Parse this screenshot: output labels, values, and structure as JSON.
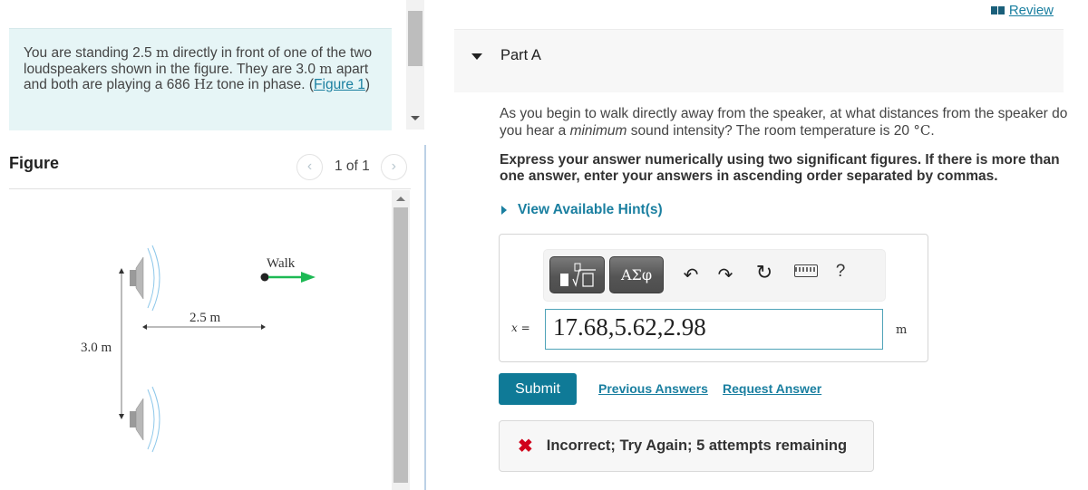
{
  "problem": {
    "intro_parts": [
      {
        "text": "You are standing 2.5 ",
        "math": false
      },
      {
        "text": "m",
        "math": true
      },
      {
        "text": " directly in front of one of the two loudspeakers shown in the figure. They are 3.0 ",
        "math": false
      },
      {
        "text": "m",
        "math": true
      },
      {
        "text": " apart and both are playing a 686 ",
        "math": false
      },
      {
        "text": "Hz",
        "math": true
      },
      {
        "text": " tone in phase. ",
        "math": false
      }
    ],
    "figure_link_open": "(",
    "figure_link": "Figure 1",
    "figure_link_close": ")"
  },
  "figure_panel": {
    "title": "Figure",
    "pager_text": "1 of 1",
    "prev_icon": "chevron-left-icon",
    "next_icon": "chevron-right-icon",
    "labels": {
      "walk": "Walk",
      "distance": "2.5 m",
      "separation": "3.0 m"
    },
    "colors": {
      "walk_arrow": "#1db954",
      "waves": "#8fc8ea",
      "speaker": "#a9a9a9"
    }
  },
  "review": {
    "icon": "book-icon",
    "label": "Review"
  },
  "part": {
    "title": "Part A",
    "question_before_em": "As you begin to walk directly away from the speaker, at what distances from the speaker do you hear a ",
    "question_em": "minimum",
    "question_after_em": " sound intensity? The room temperature is 20 ",
    "question_unit": "°C",
    "question_end": ".",
    "instruction": "Express your answer numerically using two significant figures. If there is more than one answer, enter your answers in ascending order separated by commas.",
    "hints_label": "View Available Hint(s)"
  },
  "answer": {
    "toolbar": {
      "templates_icon": "templates-icon",
      "symbols_label": "ΑΣφ",
      "undo_icon": "undo-icon",
      "redo_icon": "redo-icon",
      "reset_icon": "reset-icon",
      "keyboard_icon": "keyboard-icon",
      "help_label": "?"
    },
    "variable": "x",
    "equals": " =",
    "value": "17.68,5.62,2.98",
    "unit": "m"
  },
  "actions": {
    "submit": "Submit",
    "previous_answers": "Previous Answers",
    "request_answer": "Request Answer"
  },
  "feedback": {
    "icon": "x-mark-icon",
    "message": "Incorrect; Try Again; 5 attempts remaining",
    "color": "#d0021b"
  },
  "theme": {
    "accent": "#0f7a97",
    "link": "#1a7fa0",
    "intro_bg": "#e6f5f6"
  }
}
